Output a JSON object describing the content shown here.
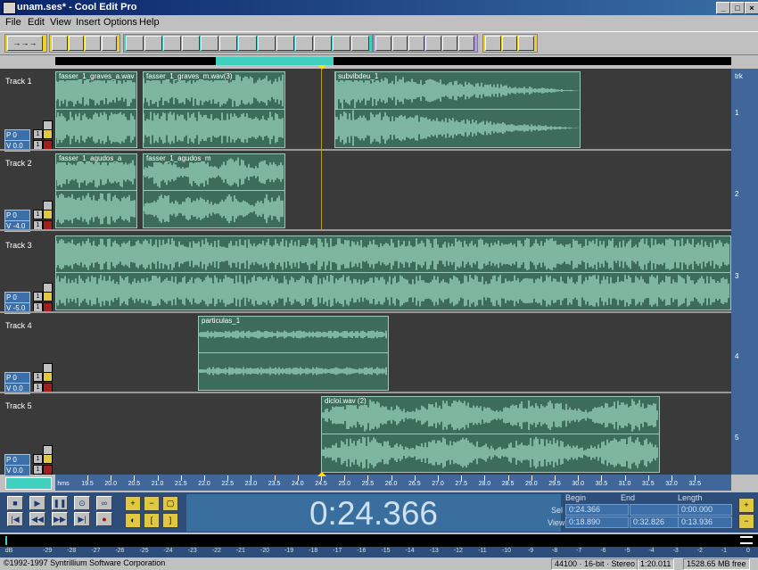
{
  "window": {
    "title": "unam.ses* - Cool Edit Pro",
    "min": "_",
    "max": "□",
    "close": "×"
  },
  "menu": [
    "File",
    "Edit",
    "View",
    "Insert",
    "Options",
    "Help"
  ],
  "toolbar": {
    "groups": [
      {
        "color": "#f0d020",
        "buttons": [
          "arrow-right"
        ]
      },
      {
        "color": "#f0d020",
        "buttons": [
          "new",
          "open",
          "save",
          "save-as"
        ]
      },
      {
        "color": "#40d0c0",
        "buttons": [
          "undo",
          "b1",
          "b2",
          "b3",
          "b4",
          "b5",
          "b6",
          "b7",
          "b8",
          "b9",
          "b10",
          "b11",
          "b12"
        ]
      },
      {
        "color": "#b09ae0",
        "buttons": [
          "c1",
          "c2",
          "c3",
          "c4",
          "c5",
          "c6"
        ]
      },
      {
        "color": "#f0d020",
        "buttons": [
          "d1",
          "d2",
          "d3"
        ]
      }
    ]
  },
  "tracks": [
    {
      "label": "Track 1",
      "pan": "P 0",
      "vol": "V 0.0",
      "num": "1"
    },
    {
      "label": "Track 2",
      "pan": "P 0",
      "vol": "V -4.0",
      "num": "2"
    },
    {
      "label": "Track 3",
      "pan": "P 0",
      "vol": "V -5.0",
      "num": "3"
    },
    {
      "label": "Track 4",
      "pan": "P 0",
      "vol": "V 0.0",
      "num": "4"
    },
    {
      "label": "Track 5",
      "pan": "P 0",
      "vol": "V 0.0",
      "num": "5"
    }
  ],
  "right_header": "trk",
  "clips": [
    {
      "track": 0,
      "name": "fasser_1_graves_a.wav"
    },
    {
      "track": 0,
      "name": "fasser_1_graves_m.wav(3)"
    },
    {
      "track": 0,
      "name": "subvibdeu_1"
    },
    {
      "track": 1,
      "name": "fasser_1_agudos_a"
    },
    {
      "track": 1,
      "name": "fasser_1_agudos_m"
    },
    {
      "track": 2,
      "name": ""
    },
    {
      "track": 3,
      "name": "particulas_1"
    },
    {
      "track": 4,
      "name": "dicloi.wav (2)"
    }
  ],
  "ruler": {
    "unit": "hms",
    "labels": [
      "19.5",
      "20.0",
      "20.5",
      "21.0",
      "21.5",
      "22.0",
      "22.5",
      "23.0",
      "23.5",
      "24.0",
      "24.5",
      "25.0",
      "25.5",
      "26.0",
      "26.5",
      "27.0",
      "27.5",
      "28.0",
      "28.5",
      "29.0",
      "29.5",
      "30.0",
      "30.5",
      "31.0",
      "31.5",
      "32.0",
      "32.5"
    ]
  },
  "transport": {
    "time": "0:24.366",
    "begin_label": "Begin",
    "end_label": "End",
    "length_label": "Length",
    "sel_label": "Sel",
    "view_label": "View",
    "sel_begin": "0:24.366",
    "sel_end": "",
    "sel_length": "0:00.000",
    "view_begin": "0:18.890",
    "view_end": "0:32.826",
    "view_length": "0:13.936"
  },
  "meter": {
    "labels": [
      "dB",
      "-29",
      "-28",
      "-27",
      "-26",
      "-25",
      "-24",
      "-23",
      "-22",
      "-21",
      "-20",
      "-19",
      "-18",
      "-17",
      "-16",
      "-15",
      "-14",
      "-13",
      "-12",
      "-11",
      "-10",
      "-9",
      "-8",
      "-7",
      "-6",
      "-5",
      "-4",
      "-3",
      "-2",
      "-1",
      "0"
    ]
  },
  "status": {
    "copyright": "©1992-1997 Syntrillium Software Corporation",
    "format": "44100 · 16-bit · Stereo",
    "duration": "1:20.011",
    "free": "1528.65 MB free"
  },
  "colors": {
    "accent": "#40d0c0",
    "wave": "#8ec8b4",
    "clip": "#3d6b5c",
    "panel": "#41679a"
  }
}
